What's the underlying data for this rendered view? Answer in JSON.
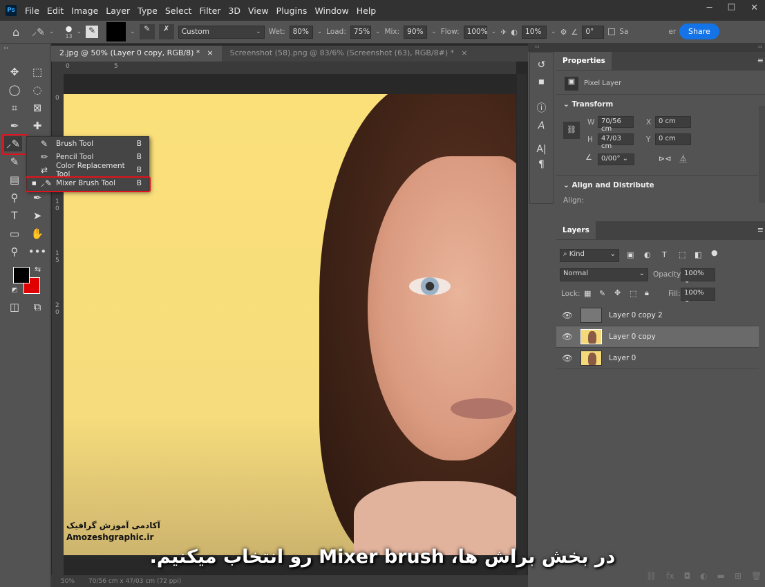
{
  "app": {
    "logo": "Ps"
  },
  "menu": [
    "File",
    "Edit",
    "Image",
    "Layer",
    "Type",
    "Select",
    "Filter",
    "3D",
    "View",
    "Plugins",
    "Window",
    "Help"
  ],
  "options": {
    "brush_size": "13",
    "preset": "Custom",
    "wet_label": "Wet:",
    "wet": "80%",
    "load_label": "Load:",
    "load": "75%",
    "mix_label": "Mix:",
    "mix": "90%",
    "flow_label": "Flow:",
    "flow": "100%",
    "smoothing": "10%",
    "angle": "0°",
    "sample_label": "Sa",
    "share": "Share",
    "after_share": "er"
  },
  "tabs": [
    {
      "label": "2.jpg @ 50% (Layer 0 copy, RGB/8) *"
    },
    {
      "label": "Screenshot (58).png @ 83/6% (Screenshot (63), RGB/8#) *"
    }
  ],
  "ruler": {
    "top": [
      "0",
      "5"
    ],
    "left": [
      "0",
      "5",
      "1 0",
      "1 5",
      "2 0"
    ]
  },
  "flyout": [
    {
      "label": "Brush Tool",
      "key": "B"
    },
    {
      "label": "Pencil Tool",
      "key": "B"
    },
    {
      "label": "Color Replacement Tool",
      "key": "B"
    },
    {
      "label": "Mixer Brush Tool",
      "key": "B",
      "selected": true
    }
  ],
  "colors": {
    "foreground": "#000000",
    "background": "#e00000",
    "highlight": "#e3111b",
    "accent": "#1473e6"
  },
  "properties": {
    "title": "Properties",
    "kind": "Pixel Layer",
    "transform": "Transform",
    "w_label": "W",
    "w": "70/56 cm",
    "h_label": "H",
    "h": "47/03 cm",
    "x_label": "X",
    "x": "0 cm",
    "y_label": "Y",
    "y": "0 cm",
    "angle": "0/00°",
    "align_section": "Align and Distribute",
    "align_label": "Align:"
  },
  "layers": {
    "title": "Layers",
    "filter": "Kind",
    "blend": "Normal",
    "opacity_label": "Opacity:",
    "opacity": "100%",
    "lock_label": "Lock:",
    "fill_label": "Fill:",
    "fill": "100%",
    "items": [
      {
        "name": "Layer 0 copy 2"
      },
      {
        "name": "Layer 0 copy",
        "selected": true
      },
      {
        "name": "Layer 0"
      }
    ]
  },
  "status": {
    "zoom": "50%",
    "size": "70/56 cm x 47/03 cm (72 ppi)"
  },
  "watermark": {
    "fa": "آکادمی آموزش گرافیک",
    "en": "Amozeshgraphic.ir"
  },
  "caption": "در بخش براش ها، Mixer brush رو انتخاب میکنیم."
}
